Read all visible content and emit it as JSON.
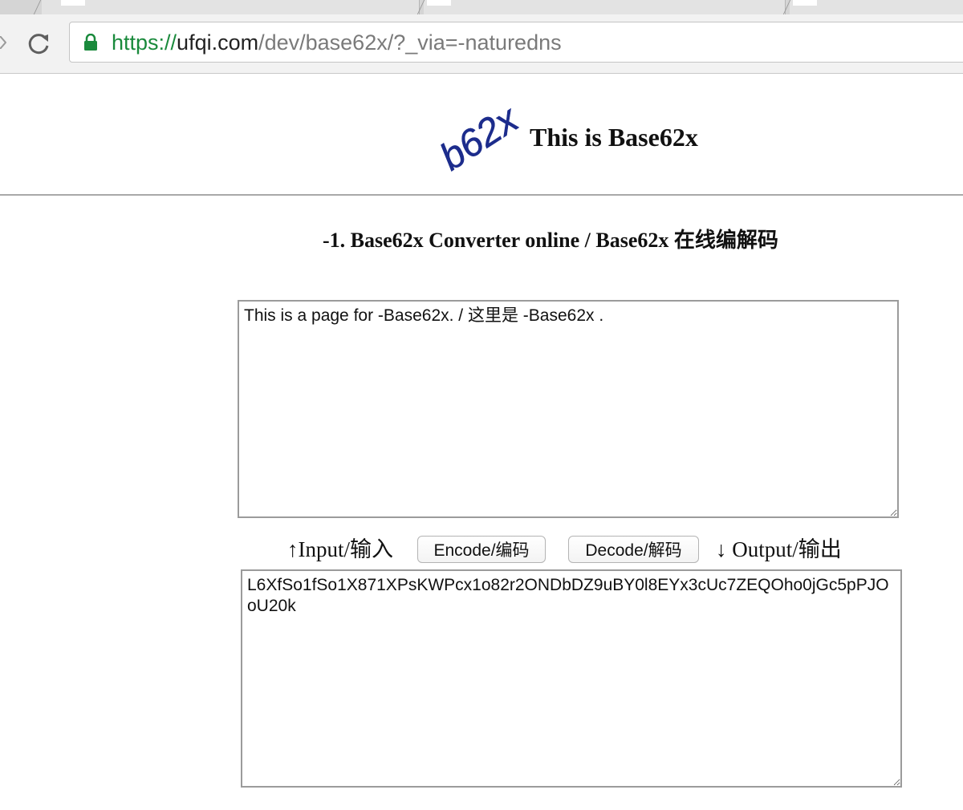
{
  "browser": {
    "url_scheme": "https://",
    "url_host": "ufqi.com",
    "url_path": "/dev/base62x/?_via=-naturedns"
  },
  "header": {
    "logo_text": "b62x",
    "title": "This is Base62x"
  },
  "section": {
    "title": "-1. Base62x Converter online / Base62x 在线编解码"
  },
  "converter": {
    "input_value": "This is a page for -Base62x. / 这里是 -Base62x .",
    "input_label": "↑Input/输入",
    "encode_label": "Encode/编码",
    "decode_label": "Decode/解码",
    "output_label": "↓ Output/输出",
    "output_value": "L6XfSo1fSo1X871XPsKWPcx1o82r2ONDbDZ9uBY0l8EYx3cUc7ZEQOho0jGc5pPJOoU20k"
  },
  "colors": {
    "url_scheme": "#1a8a3c",
    "lock": "#1a8a3c",
    "logo": "#1c2c8c"
  },
  "icons": {
    "lock": "lock-icon",
    "reload": "reload-icon",
    "back": "back-arrow-icon"
  }
}
